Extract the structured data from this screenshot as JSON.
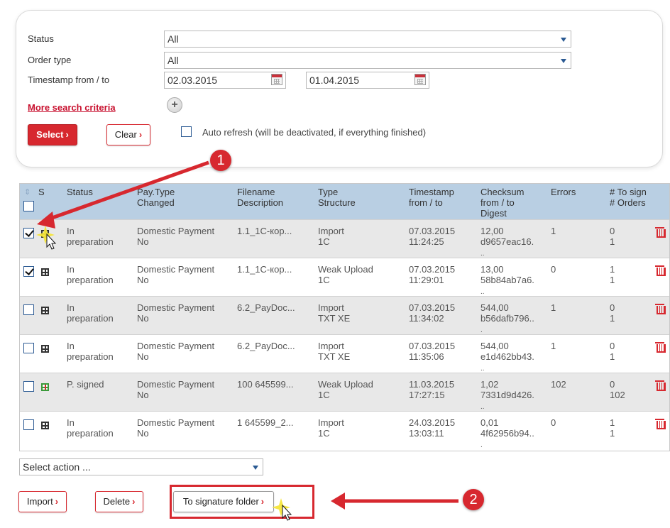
{
  "search": {
    "status_label": "Status",
    "status_value": "All",
    "order_type_label": "Order type",
    "order_type_value": "All",
    "timestamp_label": "Timestamp from / to",
    "date_from": "02.03.2015",
    "date_to": "01.04.2015",
    "more_criteria": "More search criteria",
    "plus": "+",
    "select_btn": "Select",
    "clear_btn": "Clear",
    "chevron": "›",
    "auto_refresh_label": "Auto refresh (will be deactivated, if everything finished)"
  },
  "table": {
    "headers": {
      "s": "S",
      "status": "Status",
      "paytype": "Pay.Type",
      "changed": "Changed",
      "filename": "Filename",
      "description": "Description",
      "type": "Type",
      "structure": "Structure",
      "timestamp": "Timestamp",
      "fromto": "from / to",
      "checksum": "Checksum",
      "checksum2": "from / to",
      "digest": "Digest",
      "errors": "Errors",
      "tosign": "# To sign",
      "orders": "# Orders"
    },
    "rows": [
      {
        "checked": true,
        "status1": "In",
        "status2": "preparation",
        "pay1": "Domestic Payment",
        "pay2": "No",
        "file": "1.1_1C-кор...",
        "type1": "Import",
        "type2": "1C",
        "ts1": "07.03.2015",
        "ts2": "11:24:25",
        "ck1": "12,00",
        "ck2": "d9657eac16.",
        "ck3": "..",
        "errors": "1",
        "sign1": "0",
        "sign2": "1"
      },
      {
        "checked": true,
        "status1": "In",
        "status2": "preparation",
        "pay1": "Domestic Payment",
        "pay2": "No",
        "file": "1.1_1C-кор...",
        "type1": "Weak Upload",
        "type2": "1C",
        "ts1": "07.03.2015",
        "ts2": "11:29:01",
        "ck1": "13,00",
        "ck2": "58b84ab7a6.",
        "ck3": "..",
        "errors": "0",
        "sign1": "1",
        "sign2": "1"
      },
      {
        "checked": false,
        "status1": "In",
        "status2": "preparation",
        "pay1": "Domestic Payment",
        "pay2": "No",
        "file": "6.2_PayDoc...",
        "type1": "Import",
        "type2": "TXT XE",
        "ts1": "07.03.2015",
        "ts2": "11:34:02",
        "ck1": "544,00",
        "ck2": "b56dafb796..",
        "ck3": ".",
        "errors": "1",
        "sign1": "0",
        "sign2": "1"
      },
      {
        "checked": false,
        "status1": "In",
        "status2": "preparation",
        "pay1": "Domestic Payment",
        "pay2": "No",
        "file": "6.2_PayDoc...",
        "type1": "Import",
        "type2": "TXT XE",
        "ts1": "07.03.2015",
        "ts2": "11:35:06",
        "ck1": "544,00",
        "ck2": "e1d462bb43.",
        "ck3": "..",
        "errors": "1",
        "sign1": "0",
        "sign2": "1"
      },
      {
        "checked": false,
        "status1": "P. signed",
        "status2": "",
        "pay1": "Domestic Payment",
        "pay2": "No",
        "file": "100 645599...",
        "type1": "Weak Upload",
        "type2": "1C",
        "ts1": "11.03.2015",
        "ts2": "17:27:15",
        "ck1": "1,02",
        "ck2": "7331d9d426.",
        "ck3": "..",
        "errors": "102",
        "sign1": "0",
        "sign2": "102"
      },
      {
        "checked": false,
        "status1": "In",
        "status2": "preparation",
        "pay1": "Domestic Payment",
        "pay2": "No",
        "file": "1 645599_2...",
        "type1": "Import",
        "type2": "1C",
        "ts1": "24.03.2015",
        "ts2": "13:03:11",
        "ck1": "0,01",
        "ck2": "4f62956b94..",
        "ck3": ".",
        "errors": "0",
        "sign1": "1",
        "sign2": "1"
      }
    ]
  },
  "actions": {
    "select_action": "Select action ...",
    "import_btn": "Import",
    "delete_btn": "Delete",
    "to_signature_btn": "To signature folder"
  },
  "annotations": {
    "badge1": "1",
    "badge2": "2"
  },
  "colors": {
    "accent": "#d7282f",
    "header_bg": "#b9cfe3",
    "row_shade": "#e8e8e8"
  }
}
